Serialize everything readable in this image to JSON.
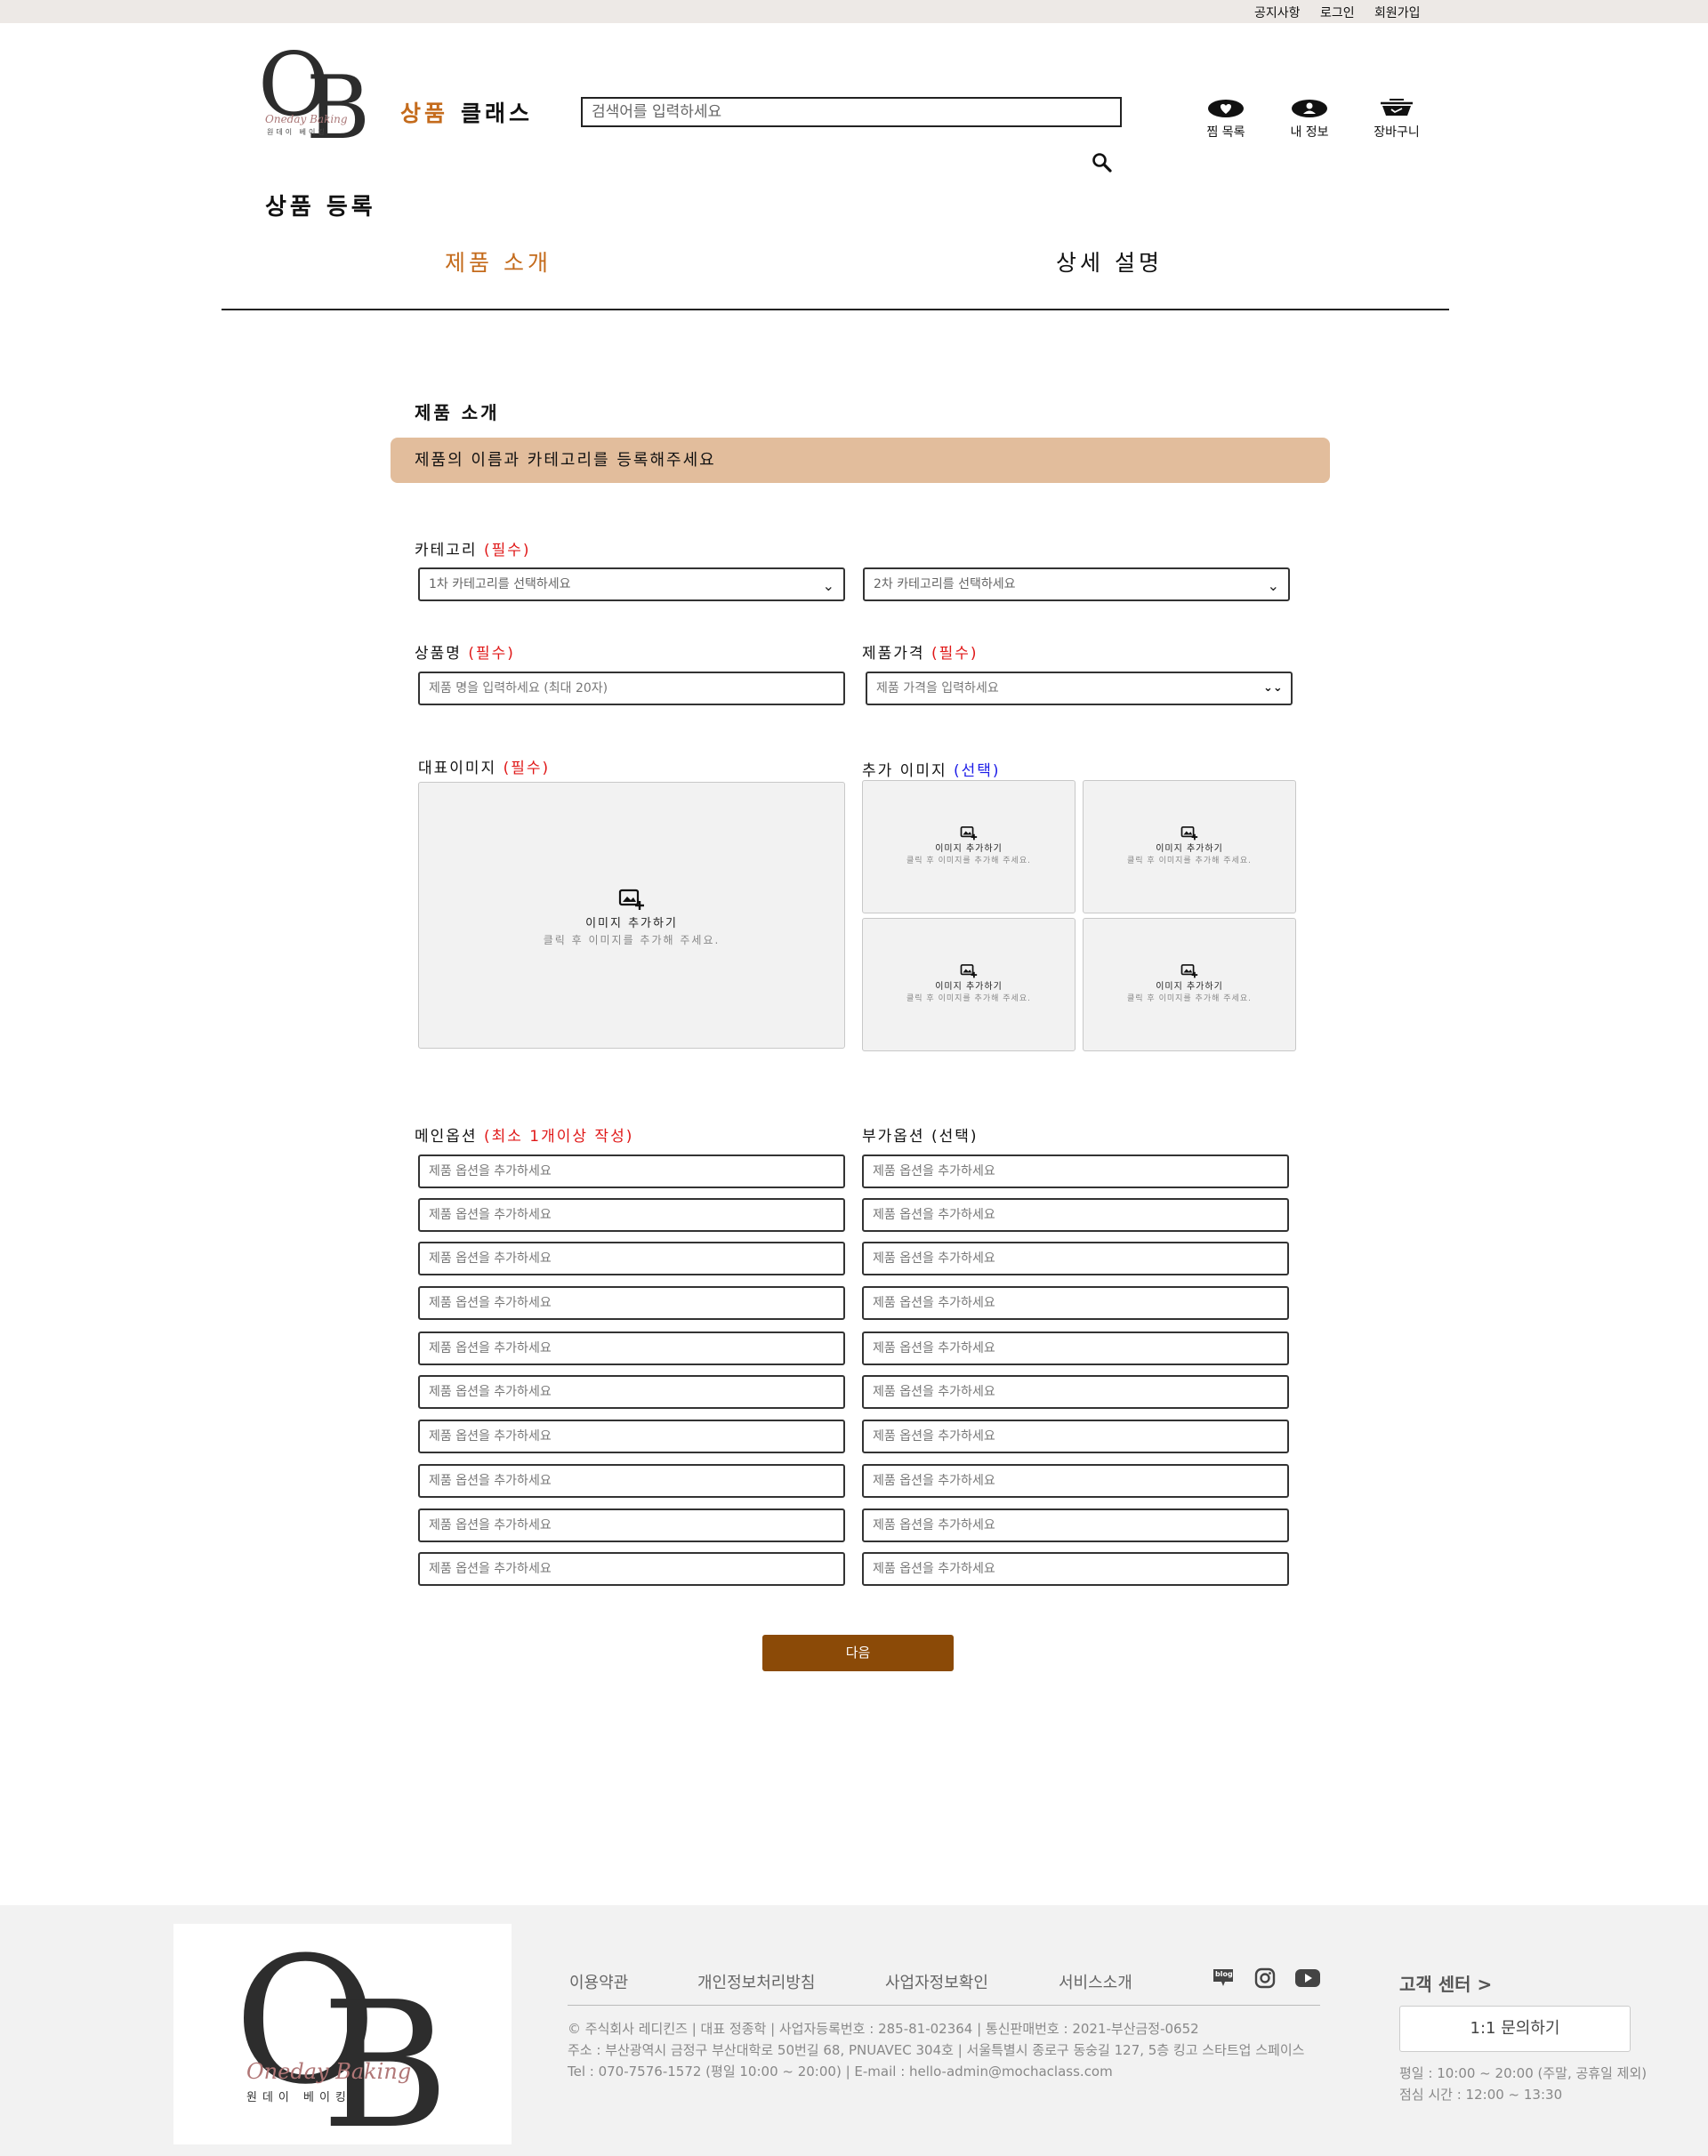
{
  "topbar": {
    "notice": "공지사항",
    "login": "로그인",
    "signup": "회원가입"
  },
  "logo": {
    "initial_o": "O",
    "initial_b": "B",
    "script": "Oneday Baking",
    "korean": "원데이 베이킹"
  },
  "nav": {
    "product": "상품",
    "class": "클래스"
  },
  "search": {
    "placeholder": "검색어를 입력하세요",
    "icon": "search-icon"
  },
  "header_icons": [
    {
      "label": "찜 목록",
      "icon": "heart-icon"
    },
    {
      "label": "내 정보",
      "icon": "user-icon"
    },
    {
      "label": "장바구니",
      "icon": "cart-icon"
    }
  ],
  "page_title": "상품 등록",
  "tabs": {
    "intro": "제품 소개",
    "detail": "상세 설명",
    "active_color": "#c46b1c"
  },
  "section": {
    "title": "제품 소개",
    "banner": "제품의 이름과 카테고리를 등록해주세요",
    "banner_color": "#e2bd9c"
  },
  "category": {
    "label": "카테고리",
    "required": "(필수)",
    "first_placeholder": "1차 카테고리를 선택하세요",
    "second_placeholder": "2차 카테고리를 선택하세요"
  },
  "product_name": {
    "label": "상품명",
    "required": "(필수)",
    "placeholder": "제품 명을 입력하세요 (최대 20자)"
  },
  "price": {
    "label": "제품가격",
    "required": "(필수)",
    "placeholder": "제품 가격을 입력하세요"
  },
  "main_image": {
    "label": "대표이미지",
    "required": "(필수)"
  },
  "extra_images": {
    "label": "추가 이미지",
    "optional": "(선택)"
  },
  "image_upload": {
    "title": "이미지 추가하기",
    "hint": "클릭 후 이미지를 추가해 주세요.",
    "icon": "add-image-icon"
  },
  "main_options": {
    "label": "메인옵션",
    "required": "(최소 1개이상 작성)",
    "placeholder": "제품 옵션을 추가하세요",
    "count": 10
  },
  "sub_options": {
    "label": "부가옵션",
    "optional": "(선택)",
    "placeholder": "제품 옵션을 추가하세요",
    "count": 10
  },
  "next_button": {
    "label": "다음",
    "color": "#8b4a07"
  },
  "footer": {
    "links": [
      "이용약관",
      "개인정보처리방침",
      "사업자정보확인",
      "서비스소개"
    ],
    "social_icons": [
      "blog-icon",
      "instagram-icon",
      "youtube-icon"
    ],
    "blog_text": "blog",
    "info_lines": [
      "© 주식회사 레디킨즈 | 대표 정종학 | 사업자등록번호 : 285-81-02364 | 통신판매번호 : 2021-부산금정-0652",
      "주소 : 부산광역시 금정구 부산대학로 50번길 68, PNUAVEC 304호 | 서울특별시 종로구 동숭길 127, 5층 킹고 스타트업 스페이스",
      "Tel : 070-7576-1572 (평일 10:00 ~ 20:00) | E-mail : hello-admin@mochaclass.com"
    ],
    "cs_title": "고객 센터 >",
    "cs_button": "1:1 문의하기",
    "hours": [
      "평일 : 10:00 ~ 20:00 (주말, 공휴일 제외)",
      "점심 시간 : 12:00 ~ 13:30"
    ]
  }
}
